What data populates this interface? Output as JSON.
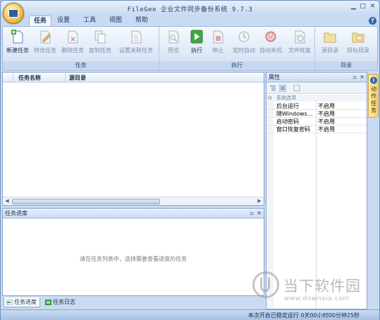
{
  "window": {
    "title": "FileGee 企业文件同步备份系统 9.7.3",
    "controls": {
      "minimize": "▁",
      "maximize": "□",
      "close": "✕"
    }
  },
  "ribbon": {
    "tabs": [
      "任务",
      "设置",
      "工具",
      "视图",
      "帮助"
    ],
    "help_icon": "?",
    "groups": {
      "task": {
        "label": "任务",
        "buttons": [
          {
            "label": "新建任务",
            "icon": "new-task-icon"
          },
          {
            "label": "修改任务",
            "icon": "edit-task-icon"
          },
          {
            "label": "删除任务",
            "icon": "delete-task-icon"
          },
          {
            "label": "复制任务",
            "icon": "copy-task-icon"
          },
          {
            "label": "设置关联任务",
            "icon": "link-task-icon"
          }
        ]
      },
      "execute": {
        "label": "执行",
        "buttons": [
          {
            "label": "预览",
            "icon": "preview-icon"
          },
          {
            "label": "执行",
            "icon": "play-icon"
          },
          {
            "label": "停止",
            "icon": "stop-icon"
          },
          {
            "label": "定时自动",
            "icon": "clock-icon"
          },
          {
            "label": "自动关机",
            "icon": "shutdown-icon"
          },
          {
            "label": "文件恢复",
            "icon": "restore-icon"
          }
        ]
      },
      "directory": {
        "label": "目录",
        "buttons": [
          {
            "label": "源目录",
            "icon": "source-folder-icon"
          },
          {
            "label": "目标目录",
            "icon": "target-folder-icon"
          }
        ]
      }
    }
  },
  "task_list": {
    "columns": [
      "任务名称",
      "源目录"
    ],
    "rows": []
  },
  "properties": {
    "title": "属性",
    "pin": "▫",
    "close": "✕",
    "category": "系统选项",
    "rows": [
      {
        "name": "后台运行",
        "value": "不启用"
      },
      {
        "name": "随Windows...",
        "value": "不启用"
      },
      {
        "name": "启动密码",
        "value": "不启用"
      },
      {
        "name": "窗口恢复密码",
        "value": "不启用"
      }
    ]
  },
  "side_tab": {
    "label": "动作任务"
  },
  "progress": {
    "title": "任务进度",
    "hint": "请在任务列表中，选择需要查看进度的任务"
  },
  "bottom_tabs": [
    "任务进度",
    "任务日志"
  ],
  "status": {
    "text": "本次开启已稳定运行 0天00小时00分钟25秒"
  },
  "watermark": {
    "text": "当下软件园",
    "url": "www.downxia.com"
  }
}
